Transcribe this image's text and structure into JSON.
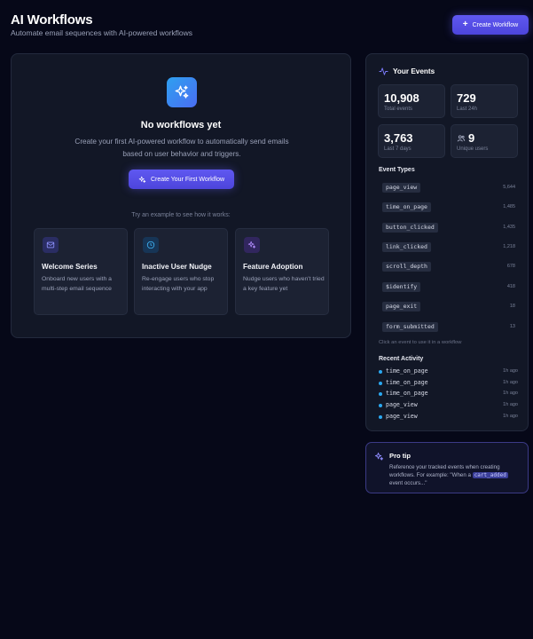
{
  "header": {
    "title": "AI Workflows",
    "subtitle": "Automate email sequences with AI-powered workflows",
    "create_button": "Create Workflow"
  },
  "empty_state": {
    "icon": "sparkles-icon",
    "title": "No workflows yet",
    "description": "Create your first AI-powered workflow to automatically send emails based on user behavior and triggers.",
    "cta_button": "Create Your First Workflow",
    "examples_hint": "Try an example to see how it works:"
  },
  "examples": [
    {
      "icon": "mail-icon",
      "title": "Welcome Series",
      "description": "Onboard new users with a multi-step email sequence",
      "color": "#6b6ff0"
    },
    {
      "icon": "clock-icon",
      "title": "Inactive User Nudge",
      "description": "Re-engage users who stop interacting with your app",
      "color": "#2aa8f0"
    },
    {
      "icon": "sparkles-icon",
      "title": "Feature Adoption",
      "description": "Nudge users who haven't tried a key feature yet",
      "color": "#9b6cf0"
    }
  ],
  "events_panel": {
    "title": "Your Events",
    "stats": [
      {
        "value": "10,908",
        "label": "Total events"
      },
      {
        "value": "729",
        "label": "Last 24h"
      },
      {
        "value": "3,763",
        "label": "Last 7 days"
      },
      {
        "value": "9",
        "label": "Unique users"
      }
    ],
    "event_types_title": "Event Types",
    "event_types": [
      {
        "name": "page_view",
        "count": "5,644"
      },
      {
        "name": "time_on_page",
        "count": "1,485"
      },
      {
        "name": "button_clicked",
        "count": "1,435"
      },
      {
        "name": "link_clicked",
        "count": "1,218"
      },
      {
        "name": "scroll_depth",
        "count": "678"
      },
      {
        "name": "$identify",
        "count": "418"
      },
      {
        "name": "page_exit",
        "count": "18"
      },
      {
        "name": "form_submitted",
        "count": "13"
      }
    ],
    "hint": "Click an event to use it in a workflow",
    "recent_title": "Recent Activity",
    "recent": [
      {
        "name": "time_on_page",
        "time": "1h ago"
      },
      {
        "name": "time_on_page",
        "time": "1h ago"
      },
      {
        "name": "time_on_page",
        "time": "1h ago"
      },
      {
        "name": "page_view",
        "time": "1h ago"
      },
      {
        "name": "page_view",
        "time": "1h ago"
      }
    ]
  },
  "pro_tip": {
    "title": "Pro tip",
    "text_before": "Reference your tracked events when creating workflows. For example: \"When a",
    "code": "cart_added",
    "text_after": "event occurs...\""
  },
  "colors": {
    "accent": "#5f58f0",
    "background": "#060818",
    "card": "#121726",
    "activity_dot": "#2aa8f0"
  }
}
